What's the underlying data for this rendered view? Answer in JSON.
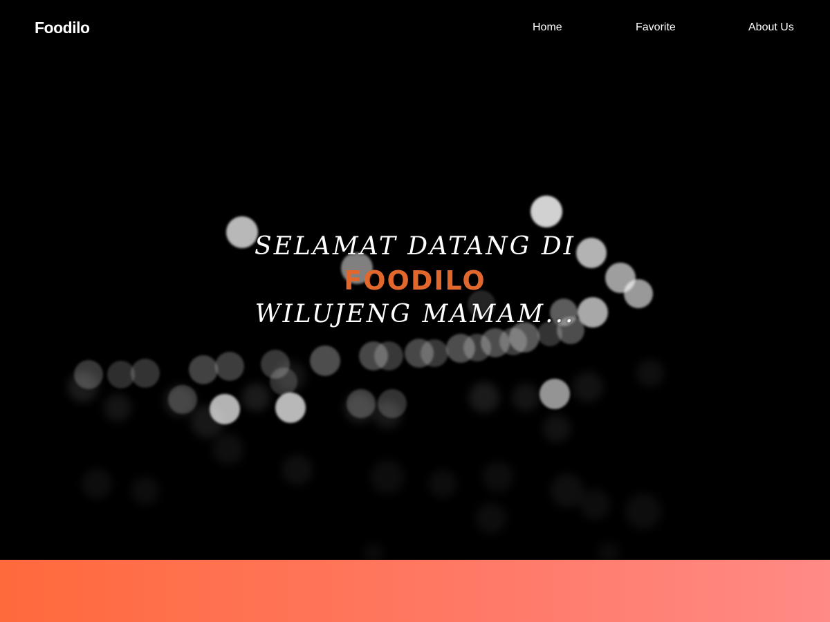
{
  "brand": "Foodilo",
  "nav": {
    "home": "Home",
    "favorite": "Favorite",
    "about": "About Us"
  },
  "hero": {
    "line1": "SELAMAT DATANG DI",
    "brand": "FOODILO",
    "line3": "WILUJENG MAMAM..."
  },
  "colors": {
    "background": "#000000",
    "accent": "#e2672c",
    "gradient_start": "#ff6a3c",
    "gradient_end": "#ff8a86"
  }
}
